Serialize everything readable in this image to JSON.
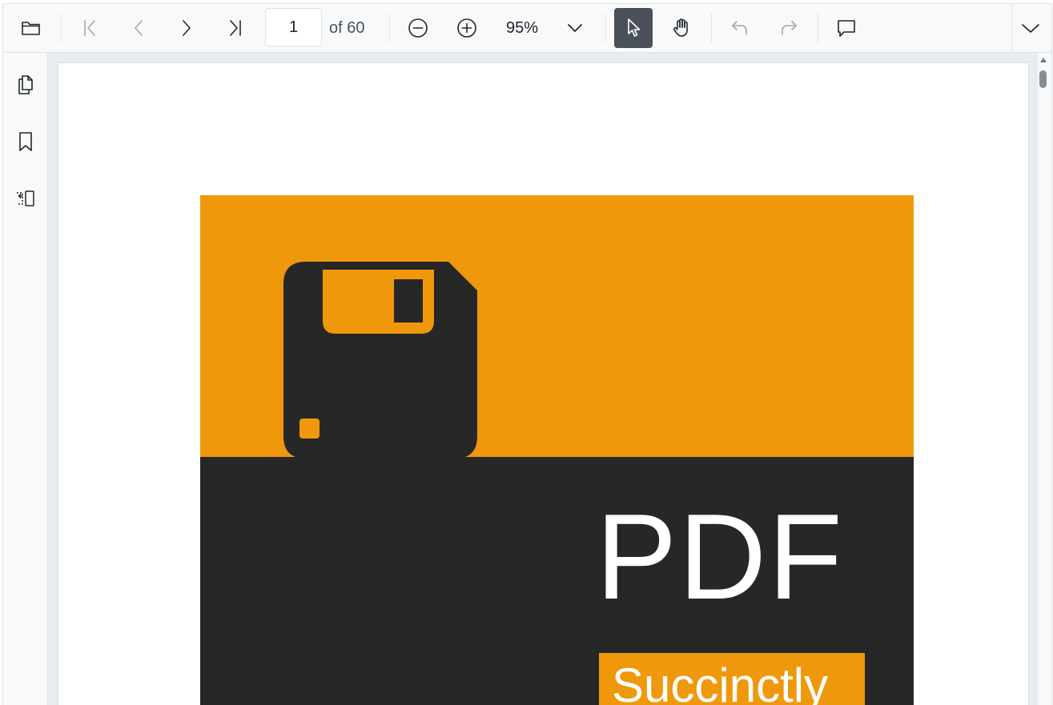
{
  "toolbar": {
    "open_icon": "folder-open-icon",
    "first_page_icon": "first-page-icon",
    "prev_page_icon": "chevron-left-icon",
    "next_page_icon": "chevron-right-icon",
    "last_page_icon": "last-page-icon",
    "current_page": "1",
    "page_of": "of 60",
    "zoom_out_icon": "zoom-out-icon",
    "zoom_in_icon": "zoom-in-icon",
    "zoom_value": "95%",
    "zoom_dropdown_icon": "chevron-down-icon",
    "selection_tool_icon": "cursor-arrow-icon",
    "pan_tool_icon": "hand-icon",
    "undo_icon": "undo-icon",
    "redo_icon": "redo-icon",
    "comment_icon": "comment-icon",
    "more_icon": "chevron-down-icon"
  },
  "sidebar": {
    "items": [
      {
        "icon": "page-thumbnails-icon"
      },
      {
        "icon": "bookmark-icon"
      },
      {
        "icon": "organize-pages-icon"
      }
    ]
  },
  "document": {
    "cover_title": "PDF",
    "cover_tagline": "Succinctly",
    "colors": {
      "accent": "#f0980b",
      "dark": "#272727",
      "active_tool": "#495057"
    }
  }
}
